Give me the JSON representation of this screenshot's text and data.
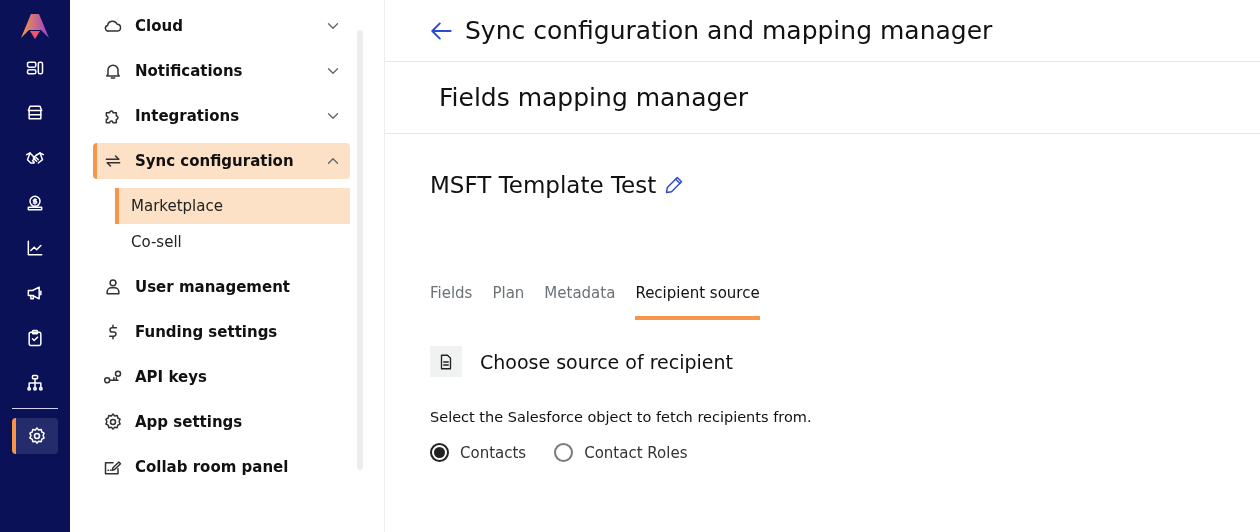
{
  "rail": {
    "items": [
      {
        "selected": false
      },
      {
        "selected": false
      },
      {
        "selected": false
      },
      {
        "selected": false
      },
      {
        "selected": false
      },
      {
        "selected": false
      },
      {
        "selected": false
      },
      {
        "selected": false
      },
      {
        "selected": true
      }
    ]
  },
  "sidebar": {
    "items": [
      {
        "kind": "group",
        "label": "Cloud",
        "expanded": false,
        "selected": false
      },
      {
        "kind": "group",
        "label": "Notifications",
        "expanded": false,
        "selected": false
      },
      {
        "kind": "group",
        "label": "Integrations",
        "expanded": false,
        "selected": false
      },
      {
        "kind": "group",
        "label": "Sync configuration",
        "expanded": true,
        "selected": true,
        "children": [
          {
            "label": "Marketplace",
            "selected": true
          },
          {
            "label": "Co-sell",
            "selected": false
          }
        ]
      },
      {
        "kind": "link",
        "label": "User management",
        "selected": false
      },
      {
        "kind": "link",
        "label": "Funding settings",
        "selected": false
      },
      {
        "kind": "link",
        "label": "API keys",
        "selected": false
      },
      {
        "kind": "link",
        "label": "App settings",
        "selected": false
      },
      {
        "kind": "link",
        "label": "Collab room panel",
        "selected": false
      }
    ]
  },
  "header": {
    "title": "Sync configuration and mapping manager"
  },
  "subheader": {
    "title": "Fields mapping manager"
  },
  "template": {
    "name": "MSFT Template Test"
  },
  "tabs": [
    {
      "label": "Fields",
      "selected": false
    },
    {
      "label": "Plan",
      "selected": false
    },
    {
      "label": "Metadata",
      "selected": false
    },
    {
      "label": "Recipient source",
      "selected": true
    }
  ],
  "section": {
    "title": "Choose source of recipient",
    "description": "Select the Salesforce object to fetch recipients from.",
    "options": [
      {
        "label": "Contacts",
        "selected": true
      },
      {
        "label": "Contact Roles",
        "selected": false
      }
    ]
  }
}
